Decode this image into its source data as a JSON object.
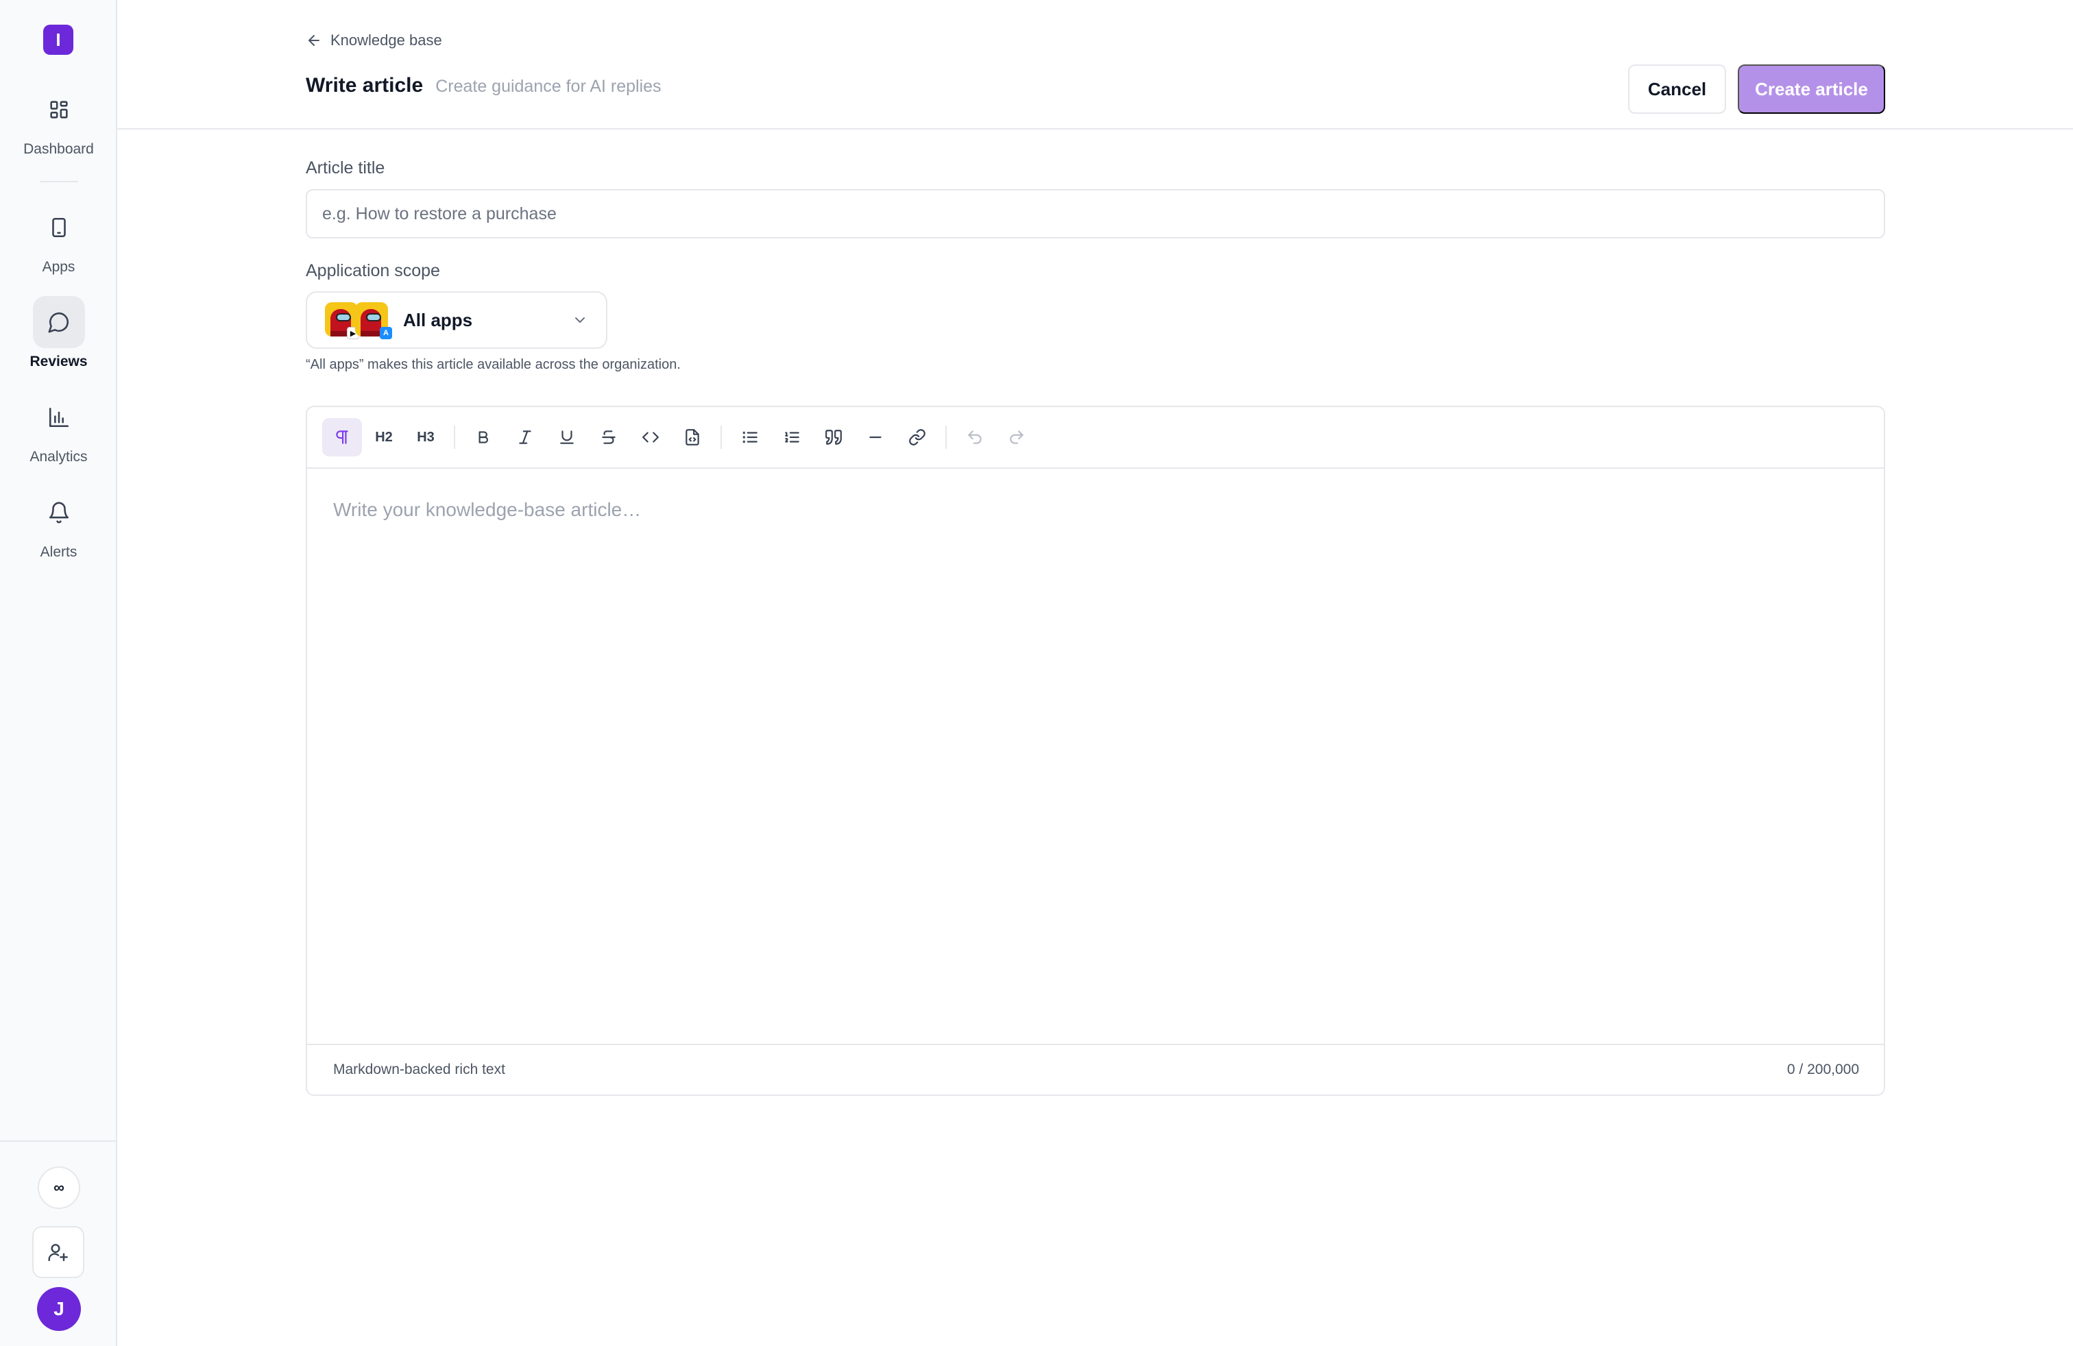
{
  "sidebar": {
    "logo_letter": "I",
    "items": [
      {
        "label": "Dashboard",
        "icon": "grid-icon"
      },
      {
        "label": "Apps",
        "icon": "phone-icon"
      },
      {
        "label": "Reviews",
        "icon": "chat-bubble-icon",
        "active": true
      },
      {
        "label": "Analytics",
        "icon": "bar-chart-icon"
      },
      {
        "label": "Alerts",
        "icon": "bell-icon"
      }
    ],
    "infinity_symbol": "∞",
    "add_user_icon": "user-plus-icon",
    "avatar_letter": "J"
  },
  "header": {
    "breadcrumb": "Knowledge base",
    "title": "Write article",
    "subtitle": "Create guidance for AI replies",
    "cancel_label": "Cancel",
    "create_label": "Create article"
  },
  "form": {
    "title_label": "Article title",
    "title_placeholder": "e.g. How to restore a purchase",
    "title_value": "",
    "scope_label": "Application scope",
    "scope_value": "All apps",
    "scope_hint": "“All apps” makes this article available across the organization."
  },
  "editor": {
    "toolbar": [
      {
        "name": "paragraph",
        "icon": "pilcrow-icon",
        "active": true
      },
      {
        "name": "heading-2",
        "text": "H2"
      },
      {
        "name": "heading-3",
        "text": "H3"
      },
      {
        "name": "bold",
        "icon": "bold-icon"
      },
      {
        "name": "italic",
        "icon": "italic-icon"
      },
      {
        "name": "underline",
        "icon": "underline-icon"
      },
      {
        "name": "strikethrough",
        "icon": "strikethrough-icon"
      },
      {
        "name": "inline-code",
        "icon": "code-icon"
      },
      {
        "name": "code-block",
        "icon": "file-code-icon"
      },
      {
        "name": "bullet-list",
        "icon": "list-icon"
      },
      {
        "name": "ordered-list",
        "icon": "list-ordered-icon"
      },
      {
        "name": "blockquote",
        "icon": "quote-icon"
      },
      {
        "name": "horizontal-rule",
        "icon": "minus-icon"
      },
      {
        "name": "link",
        "icon": "link-icon"
      },
      {
        "name": "undo",
        "icon": "undo-icon",
        "disabled": true
      },
      {
        "name": "redo",
        "icon": "redo-icon",
        "disabled": true
      }
    ],
    "placeholder": "Write your knowledge-base article…",
    "footer_left": "Markdown-backed rich text",
    "char_count": "0 / 200,000"
  },
  "colors": {
    "brand": "#6d28d9",
    "primary_button_disabled": "#b491e8",
    "active_tool": "#7c3aed"
  }
}
